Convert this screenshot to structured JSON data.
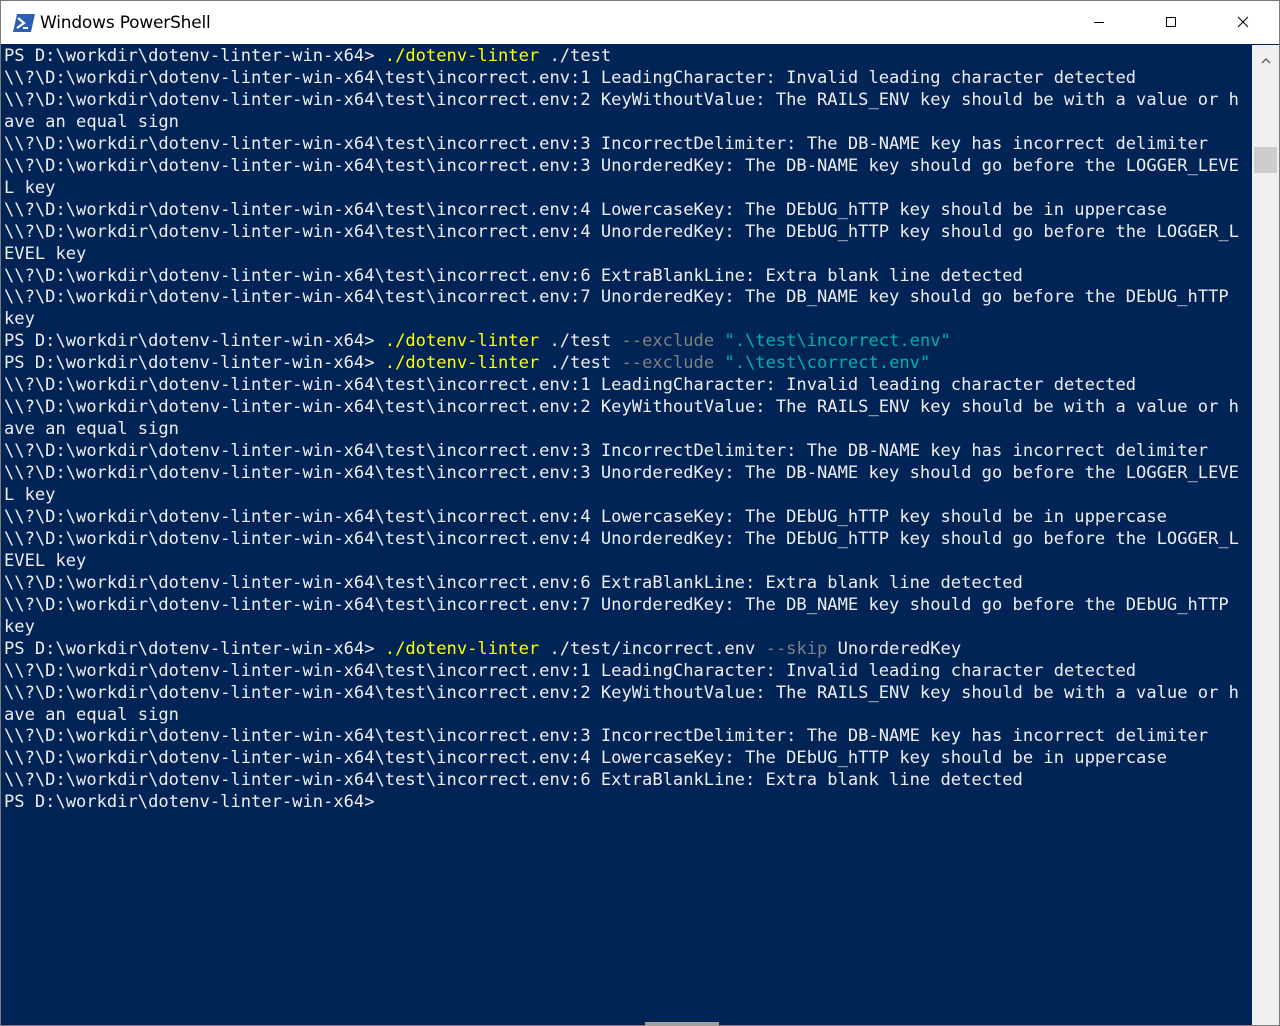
{
  "window": {
    "title": "Windows PowerShell",
    "controls": {
      "minimize": "minimize-icon",
      "maximize": "maximize-icon",
      "close": "close-icon"
    }
  },
  "colors": {
    "console_bg": "#012456",
    "text": "#eeedf0",
    "command": "#ffff00",
    "parameter": "#808080",
    "string": "#00b0b0"
  },
  "console": {
    "lines": [
      [
        {
          "t": "PS D:\\workdir\\dotenv-linter-win-x64> ",
          "c": "normal"
        },
        {
          "t": "./dotenv-linter",
          "c": "cmd"
        },
        {
          "t": " ./test",
          "c": "normal"
        }
      ],
      [
        {
          "t": "\\\\?\\D:\\workdir\\dotenv-linter-win-x64\\test\\incorrect.env:1 LeadingCharacter: Invalid leading character detected",
          "c": "normal"
        }
      ],
      [
        {
          "t": "\\\\?\\D:\\workdir\\dotenv-linter-win-x64\\test\\incorrect.env:2 KeyWithoutValue: The RAILS_ENV key should be with a value or h",
          "c": "normal"
        }
      ],
      [
        {
          "t": "ave an equal sign",
          "c": "normal"
        }
      ],
      [
        {
          "t": "\\\\?\\D:\\workdir\\dotenv-linter-win-x64\\test\\incorrect.env:3 IncorrectDelimiter: The DB-NAME key has incorrect delimiter",
          "c": "normal"
        }
      ],
      [
        {
          "t": "\\\\?\\D:\\workdir\\dotenv-linter-win-x64\\test\\incorrect.env:3 UnorderedKey: The DB-NAME key should go before the LOGGER_LEVE",
          "c": "normal"
        }
      ],
      [
        {
          "t": "L key",
          "c": "normal"
        }
      ],
      [
        {
          "t": "\\\\?\\D:\\workdir\\dotenv-linter-win-x64\\test\\incorrect.env:4 LowercaseKey: The DEbUG_hTTP key should be in uppercase",
          "c": "normal"
        }
      ],
      [
        {
          "t": "\\\\?\\D:\\workdir\\dotenv-linter-win-x64\\test\\incorrect.env:4 UnorderedKey: The DEbUG_hTTP key should go before the LOGGER_L",
          "c": "normal"
        }
      ],
      [
        {
          "t": "EVEL key",
          "c": "normal"
        }
      ],
      [
        {
          "t": "\\\\?\\D:\\workdir\\dotenv-linter-win-x64\\test\\incorrect.env:6 ExtraBlankLine: Extra blank line detected",
          "c": "normal"
        }
      ],
      [
        {
          "t": "\\\\?\\D:\\workdir\\dotenv-linter-win-x64\\test\\incorrect.env:7 UnorderedKey: The DB_NAME key should go before the DEbUG_hTTP",
          "c": "normal"
        }
      ],
      [
        {
          "t": "key",
          "c": "normal"
        }
      ],
      [
        {
          "t": "PS D:\\workdir\\dotenv-linter-win-x64> ",
          "c": "normal"
        },
        {
          "t": "./dotenv-linter",
          "c": "cmd"
        },
        {
          "t": " ./test ",
          "c": "normal"
        },
        {
          "t": "--exclude",
          "c": "param"
        },
        {
          "t": " ",
          "c": "normal"
        },
        {
          "t": "\".\\test\\incorrect.env\"",
          "c": "str"
        }
      ],
      [
        {
          "t": "PS D:\\workdir\\dotenv-linter-win-x64> ",
          "c": "normal"
        },
        {
          "t": "./dotenv-linter",
          "c": "cmd"
        },
        {
          "t": " ./test ",
          "c": "normal"
        },
        {
          "t": "--exclude",
          "c": "param"
        },
        {
          "t": " ",
          "c": "normal"
        },
        {
          "t": "\".\\test\\correct.env\"",
          "c": "str"
        }
      ],
      [
        {
          "t": "\\\\?\\D:\\workdir\\dotenv-linter-win-x64\\test\\incorrect.env:1 LeadingCharacter: Invalid leading character detected",
          "c": "normal"
        }
      ],
      [
        {
          "t": "\\\\?\\D:\\workdir\\dotenv-linter-win-x64\\test\\incorrect.env:2 KeyWithoutValue: The RAILS_ENV key should be with a value or h",
          "c": "normal"
        }
      ],
      [
        {
          "t": "ave an equal sign",
          "c": "normal"
        }
      ],
      [
        {
          "t": "\\\\?\\D:\\workdir\\dotenv-linter-win-x64\\test\\incorrect.env:3 IncorrectDelimiter: The DB-NAME key has incorrect delimiter",
          "c": "normal"
        }
      ],
      [
        {
          "t": "\\\\?\\D:\\workdir\\dotenv-linter-win-x64\\test\\incorrect.env:3 UnorderedKey: The DB-NAME key should go before the LOGGER_LEVE",
          "c": "normal"
        }
      ],
      [
        {
          "t": "L key",
          "c": "normal"
        }
      ],
      [
        {
          "t": "\\\\?\\D:\\workdir\\dotenv-linter-win-x64\\test\\incorrect.env:4 LowercaseKey: The DEbUG_hTTP key should be in uppercase",
          "c": "normal"
        }
      ],
      [
        {
          "t": "\\\\?\\D:\\workdir\\dotenv-linter-win-x64\\test\\incorrect.env:4 UnorderedKey: The DEbUG_hTTP key should go before the LOGGER_L",
          "c": "normal"
        }
      ],
      [
        {
          "t": "EVEL key",
          "c": "normal"
        }
      ],
      [
        {
          "t": "\\\\?\\D:\\workdir\\dotenv-linter-win-x64\\test\\incorrect.env:6 ExtraBlankLine: Extra blank line detected",
          "c": "normal"
        }
      ],
      [
        {
          "t": "\\\\?\\D:\\workdir\\dotenv-linter-win-x64\\test\\incorrect.env:7 UnorderedKey: The DB_NAME key should go before the DEbUG_hTTP",
          "c": "normal"
        }
      ],
      [
        {
          "t": "key",
          "c": "normal"
        }
      ],
      [
        {
          "t": "PS D:\\workdir\\dotenv-linter-win-x64> ",
          "c": "normal"
        },
        {
          "t": "./dotenv-linter",
          "c": "cmd"
        },
        {
          "t": " ./test/incorrect.env ",
          "c": "normal"
        },
        {
          "t": "--skip",
          "c": "param"
        },
        {
          "t": " UnorderedKey",
          "c": "normal"
        }
      ],
      [
        {
          "t": "\\\\?\\D:\\workdir\\dotenv-linter-win-x64\\test\\incorrect.env:1 LeadingCharacter: Invalid leading character detected",
          "c": "normal"
        }
      ],
      [
        {
          "t": "\\\\?\\D:\\workdir\\dotenv-linter-win-x64\\test\\incorrect.env:2 KeyWithoutValue: The RAILS_ENV key should be with a value or h",
          "c": "normal"
        }
      ],
      [
        {
          "t": "ave an equal sign",
          "c": "normal"
        }
      ],
      [
        {
          "t": "\\\\?\\D:\\workdir\\dotenv-linter-win-x64\\test\\incorrect.env:3 IncorrectDelimiter: The DB-NAME key has incorrect delimiter",
          "c": "normal"
        }
      ],
      [
        {
          "t": "\\\\?\\D:\\workdir\\dotenv-linter-win-x64\\test\\incorrect.env:4 LowercaseKey: The DEbUG_hTTP key should be in uppercase",
          "c": "normal"
        }
      ],
      [
        {
          "t": "\\\\?\\D:\\workdir\\dotenv-linter-win-x64\\test\\incorrect.env:6 ExtraBlankLine: Extra blank line detected",
          "c": "normal"
        }
      ],
      [
        {
          "t": "PS D:\\workdir\\dotenv-linter-win-x64>",
          "c": "normal"
        }
      ]
    ]
  }
}
